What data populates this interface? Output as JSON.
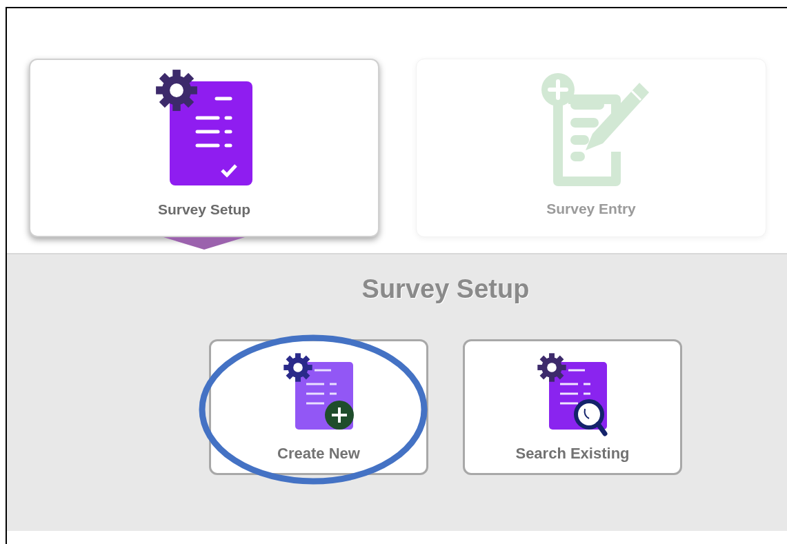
{
  "modules": [
    {
      "label": "Survey Setup",
      "kind": "setup",
      "selected": true,
      "disabled": false
    },
    {
      "label": "Survey Entry",
      "kind": "entry",
      "selected": false,
      "disabled": true
    }
  ],
  "panel": {
    "title": "Survey Setup",
    "actions": [
      {
        "label": "Create New",
        "kind": "create",
        "circled": true
      },
      {
        "label": "Search Existing",
        "kind": "search",
        "circled": false
      }
    ]
  }
}
